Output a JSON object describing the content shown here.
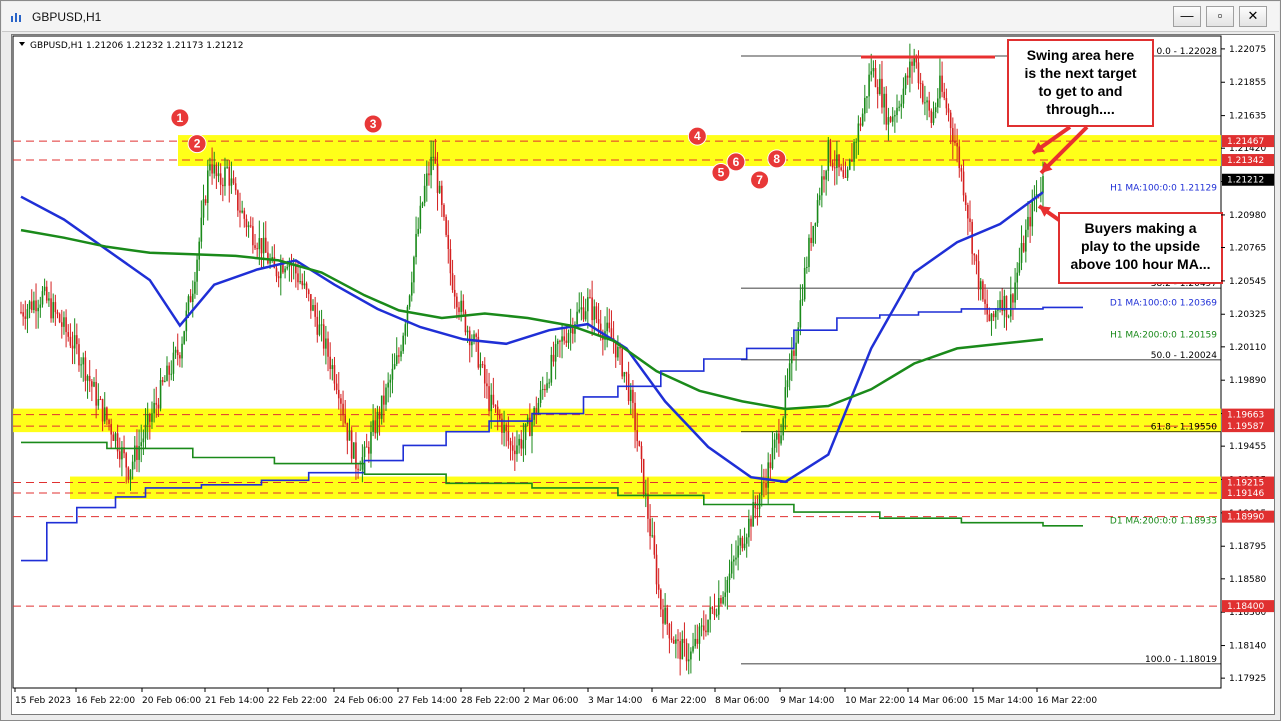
{
  "window": {
    "title": "GBPUSD,H1",
    "minimize": "—",
    "restore": "▫",
    "close": "✕"
  },
  "chart_data": {
    "type": "candlestick",
    "symbol": "GBPUSD",
    "timeframe": "H1",
    "ohlc_header": "GBPUSD,H1  1.21206 1.21232 1.21173 1.21212",
    "last_price": "1.21212",
    "ylim": [
      1.1786,
      1.2216
    ],
    "price_ticks": [
      "1.22075",
      "1.21855",
      "1.21635",
      "1.21420",
      "1.21200",
      "1.20980",
      "1.20765",
      "1.20545",
      "1.20325",
      "1.20110",
      "1.19890",
      "1.19670",
      "1.19455",
      "1.19235",
      "1.19015",
      "1.18795",
      "1.18580",
      "1.18360",
      "1.18140",
      "1.17925"
    ],
    "time_ticks": [
      "15 Feb 2023",
      "16 Feb 22:00",
      "20 Feb 06:00",
      "21 Feb 14:00",
      "22 Feb 22:00",
      "24 Feb 06:00",
      "27 Feb 14:00",
      "28 Feb 22:00",
      "2 Mar 06:00",
      "3 Mar 14:00",
      "6 Mar 22:00",
      "8 Mar 06:00",
      "9 Mar 14:00",
      "10 Mar 22:00",
      "14 Mar 06:00",
      "15 Mar 14:00",
      "16 Mar 22:00"
    ],
    "price_path": [
      [
        0,
        1.2034
      ],
      [
        10,
        1.2045
      ],
      [
        18,
        1.2028
      ],
      [
        28,
        1.2004
      ],
      [
        36,
        1.1974
      ],
      [
        44,
        1.1952
      ],
      [
        50,
        1.193
      ],
      [
        58,
        1.1955
      ],
      [
        66,
        1.1985
      ],
      [
        74,
        1.201
      ],
      [
        80,
        1.2052
      ],
      [
        84,
        1.209
      ],
      [
        88,
        1.2135
      ],
      [
        92,
        1.2118
      ],
      [
        96,
        1.2128
      ],
      [
        100,
        1.2108
      ],
      [
        106,
        1.209
      ],
      [
        112,
        1.2078
      ],
      [
        118,
        1.206
      ],
      [
        124,
        1.207
      ],
      [
        130,
        1.2055
      ],
      [
        136,
        1.2035
      ],
      [
        142,
        1.201
      ],
      [
        148,
        1.1985
      ],
      [
        152,
        1.1955
      ],
      [
        156,
        1.1935
      ],
      [
        160,
        1.1938
      ],
      [
        164,
        1.1955
      ],
      [
        170,
        1.198
      ],
      [
        176,
        1.2005
      ],
      [
        180,
        1.204
      ],
      [
        184,
        1.208
      ],
      [
        188,
        1.2115
      ],
      [
        192,
        1.2138
      ],
      [
        196,
        1.21
      ],
      [
        200,
        1.206
      ],
      [
        206,
        1.203
      ],
      [
        212,
        1.201
      ],
      [
        218,
        1.1975
      ],
      [
        224,
        1.196
      ],
      [
        228,
        1.1945
      ],
      [
        234,
        1.195
      ],
      [
        240,
        1.197
      ],
      [
        246,
        1.1995
      ],
      [
        252,
        1.2015
      ],
      [
        258,
        1.203
      ],
      [
        264,
        1.204
      ],
      [
        270,
        1.2025
      ],
      [
        276,
        1.2015
      ],
      [
        282,
        1.199
      ],
      [
        286,
        1.196
      ],
      [
        290,
        1.192
      ],
      [
        294,
        1.188
      ],
      [
        298,
        1.184
      ],
      [
        302,
        1.1825
      ],
      [
        306,
        1.1812
      ],
      [
        312,
        1.1808
      ],
      [
        318,
        1.1826
      ],
      [
        324,
        1.1842
      ],
      [
        330,
        1.186
      ],
      [
        336,
        1.1885
      ],
      [
        342,
        1.1905
      ],
      [
        348,
        1.193
      ],
      [
        354,
        1.196
      ],
      [
        360,
        1.201
      ],
      [
        364,
        1.205
      ],
      [
        368,
        1.2085
      ],
      [
        372,
        1.2115
      ],
      [
        376,
        1.214
      ],
      [
        380,
        1.213
      ],
      [
        384,
        1.2115
      ],
      [
        388,
        1.2145
      ],
      [
        392,
        1.2165
      ],
      [
        396,
        1.2195
      ],
      [
        400,
        1.2182
      ],
      [
        404,
        1.216
      ],
      [
        408,
        1.217
      ],
      [
        412,
        1.2185
      ],
      [
        416,
        1.2203
      ],
      [
        420,
        1.2178
      ],
      [
        424,
        1.216
      ],
      [
        428,
        1.2182
      ],
      [
        432,
        1.2165
      ],
      [
        436,
        1.214
      ],
      [
        440,
        1.211
      ],
      [
        444,
        1.207
      ],
      [
        448,
        1.204
      ],
      [
        452,
        1.2025
      ],
      [
        456,
        1.2045
      ],
      [
        460,
        1.2035
      ],
      [
        464,
        1.206
      ],
      [
        468,
        1.2085
      ],
      [
        472,
        1.2108
      ],
      [
        476,
        1.2121
      ]
    ],
    "moving_averages": [
      {
        "name": "H1 MA:100:0:0",
        "value": "1.21129",
        "color": "#1f2fd6",
        "path": [
          [
            0,
            1.211
          ],
          [
            20,
            1.2095
          ],
          [
            40,
            1.2075
          ],
          [
            60,
            1.2055
          ],
          [
            74,
            1.2025
          ],
          [
            90,
            1.2052
          ],
          [
            110,
            1.2062
          ],
          [
            128,
            1.2068
          ],
          [
            146,
            1.2052
          ],
          [
            166,
            1.2036
          ],
          [
            186,
            1.2024
          ],
          [
            206,
            1.2016
          ],
          [
            226,
            1.2013
          ],
          [
            246,
            1.2022
          ],
          [
            264,
            1.2026
          ],
          [
            282,
            1.201
          ],
          [
            300,
            1.1975
          ],
          [
            320,
            1.1945
          ],
          [
            340,
            1.1925
          ],
          [
            356,
            1.1922
          ],
          [
            376,
            1.194
          ],
          [
            396,
            1.201
          ],
          [
            416,
            1.206
          ],
          [
            436,
            1.208
          ],
          [
            456,
            1.2092
          ],
          [
            476,
            1.2113
          ]
        ]
      },
      {
        "name": "H1 MA:200:0:0",
        "value": "1.20159",
        "color": "#1a8a1a",
        "path": [
          [
            0,
            1.2088
          ],
          [
            20,
            1.2083
          ],
          [
            40,
            1.2077
          ],
          [
            60,
            1.2073
          ],
          [
            80,
            1.2072
          ],
          [
            100,
            1.2071
          ],
          [
            120,
            1.2068
          ],
          [
            140,
            1.206
          ],
          [
            160,
            1.2045
          ],
          [
            176,
            1.2035
          ],
          [
            196,
            1.203
          ],
          [
            216,
            1.2033
          ],
          [
            236,
            1.203
          ],
          [
            256,
            1.2025
          ],
          [
            276,
            1.2015
          ],
          [
            296,
            1.1995
          ],
          [
            316,
            1.1982
          ],
          [
            336,
            1.1975
          ],
          [
            356,
            1.197
          ],
          [
            376,
            1.1972
          ],
          [
            396,
            1.1983
          ],
          [
            416,
            1.2
          ],
          [
            436,
            1.201
          ],
          [
            456,
            1.2013
          ],
          [
            476,
            1.2016
          ]
        ]
      },
      {
        "name": "D1 MA:100:0:0",
        "value": "1.20369",
        "color": "#1f2fd6",
        "step": [
          [
            0,
            1.187
          ],
          [
            12,
            1.1895
          ],
          [
            26,
            1.1905
          ],
          [
            44,
            1.1912
          ],
          [
            58,
            1.1918
          ],
          [
            84,
            1.192
          ],
          [
            112,
            1.1923
          ],
          [
            134,
            1.1928
          ],
          [
            160,
            1.1936
          ],
          [
            178,
            1.1946
          ],
          [
            198,
            1.1955
          ],
          [
            218,
            1.1962
          ],
          [
            238,
            1.1967
          ],
          [
            262,
            1.1978
          ],
          [
            278,
            1.1985
          ],
          [
            298,
            1.1995
          ],
          [
            318,
            1.2003
          ],
          [
            338,
            1.201
          ],
          [
            360,
            1.2022
          ],
          [
            380,
            1.203
          ],
          [
            400,
            1.2032
          ],
          [
            418,
            1.2034
          ],
          [
            438,
            1.2036
          ],
          [
            476,
            1.2037
          ]
        ]
      },
      {
        "name": "D1 MA:200:0:0",
        "value": "1.18933",
        "color": "#1a8a1a",
        "step": [
          [
            0,
            1.1948
          ],
          [
            40,
            1.1944
          ],
          [
            80,
            1.1938
          ],
          [
            118,
            1.1934
          ],
          [
            160,
            1.1927
          ],
          [
            198,
            1.1921
          ],
          [
            238,
            1.1918
          ],
          [
            278,
            1.1913
          ],
          [
            318,
            1.1907
          ],
          [
            360,
            1.1902
          ],
          [
            400,
            1.1898
          ],
          [
            438,
            1.1895
          ],
          [
            476,
            1.1893
          ]
        ]
      }
    ],
    "horizontal_levels": [
      {
        "value": "1.21467",
        "color": "#e03030",
        "style": "dashed"
      },
      {
        "value": "1.21342",
        "color": "#e03030",
        "style": "dashed"
      },
      {
        "value": "1.19663",
        "color": "#e03030",
        "style": "dashed"
      },
      {
        "value": "1.19587",
        "color": "#e03030",
        "style": "dashed"
      },
      {
        "value": "1.19215",
        "color": "#e03030",
        "style": "dashed"
      },
      {
        "value": "1.19146",
        "color": "#e03030",
        "style": "dashed"
      },
      {
        "value": "1.18990",
        "color": "#e03030",
        "style": "dashed"
      },
      {
        "value": "1.18400",
        "color": "#e03030",
        "style": "dashed"
      }
    ],
    "yellow_zones": [
      [
        1.21342,
        1.21467
      ],
      [
        1.19587,
        1.19663
      ],
      [
        1.19146,
        1.19215
      ]
    ],
    "fibonacci": [
      {
        "label": "0.0 - 1.22028",
        "value": 1.22028
      },
      {
        "label": "38.2 - 1.20497",
        "value": 1.20497
      },
      {
        "label": "50.0 - 1.20024",
        "value": 1.20024
      },
      {
        "label": "61.8 - 1.19550",
        "value": 1.1955
      },
      {
        "label": "100.0 - 1.18019",
        "value": 1.18019
      }
    ],
    "swing_markers": [
      {
        "label": "1",
        "x": 74,
        "y": 1.2162
      },
      {
        "label": "2",
        "x": 82,
        "y": 1.2145
      },
      {
        "label": "3",
        "x": 164,
        "y": 1.2158
      },
      {
        "label": "4",
        "x": 315,
        "y": 1.215
      },
      {
        "label": "5",
        "x": 326,
        "y": 1.2126
      },
      {
        "label": "6",
        "x": 333,
        "y": 1.2133
      },
      {
        "label": "7",
        "x": 344,
        "y": 1.2121
      },
      {
        "label": "8",
        "x": 352,
        "y": 1.2135
      }
    ],
    "annotations": [
      {
        "text": [
          "Swing area here",
          "is the next target",
          "to get to and",
          "through...."
        ]
      },
      {
        "text": [
          "Buyers making a",
          "play to the upside",
          "above 100 hour MA..."
        ]
      }
    ]
  }
}
